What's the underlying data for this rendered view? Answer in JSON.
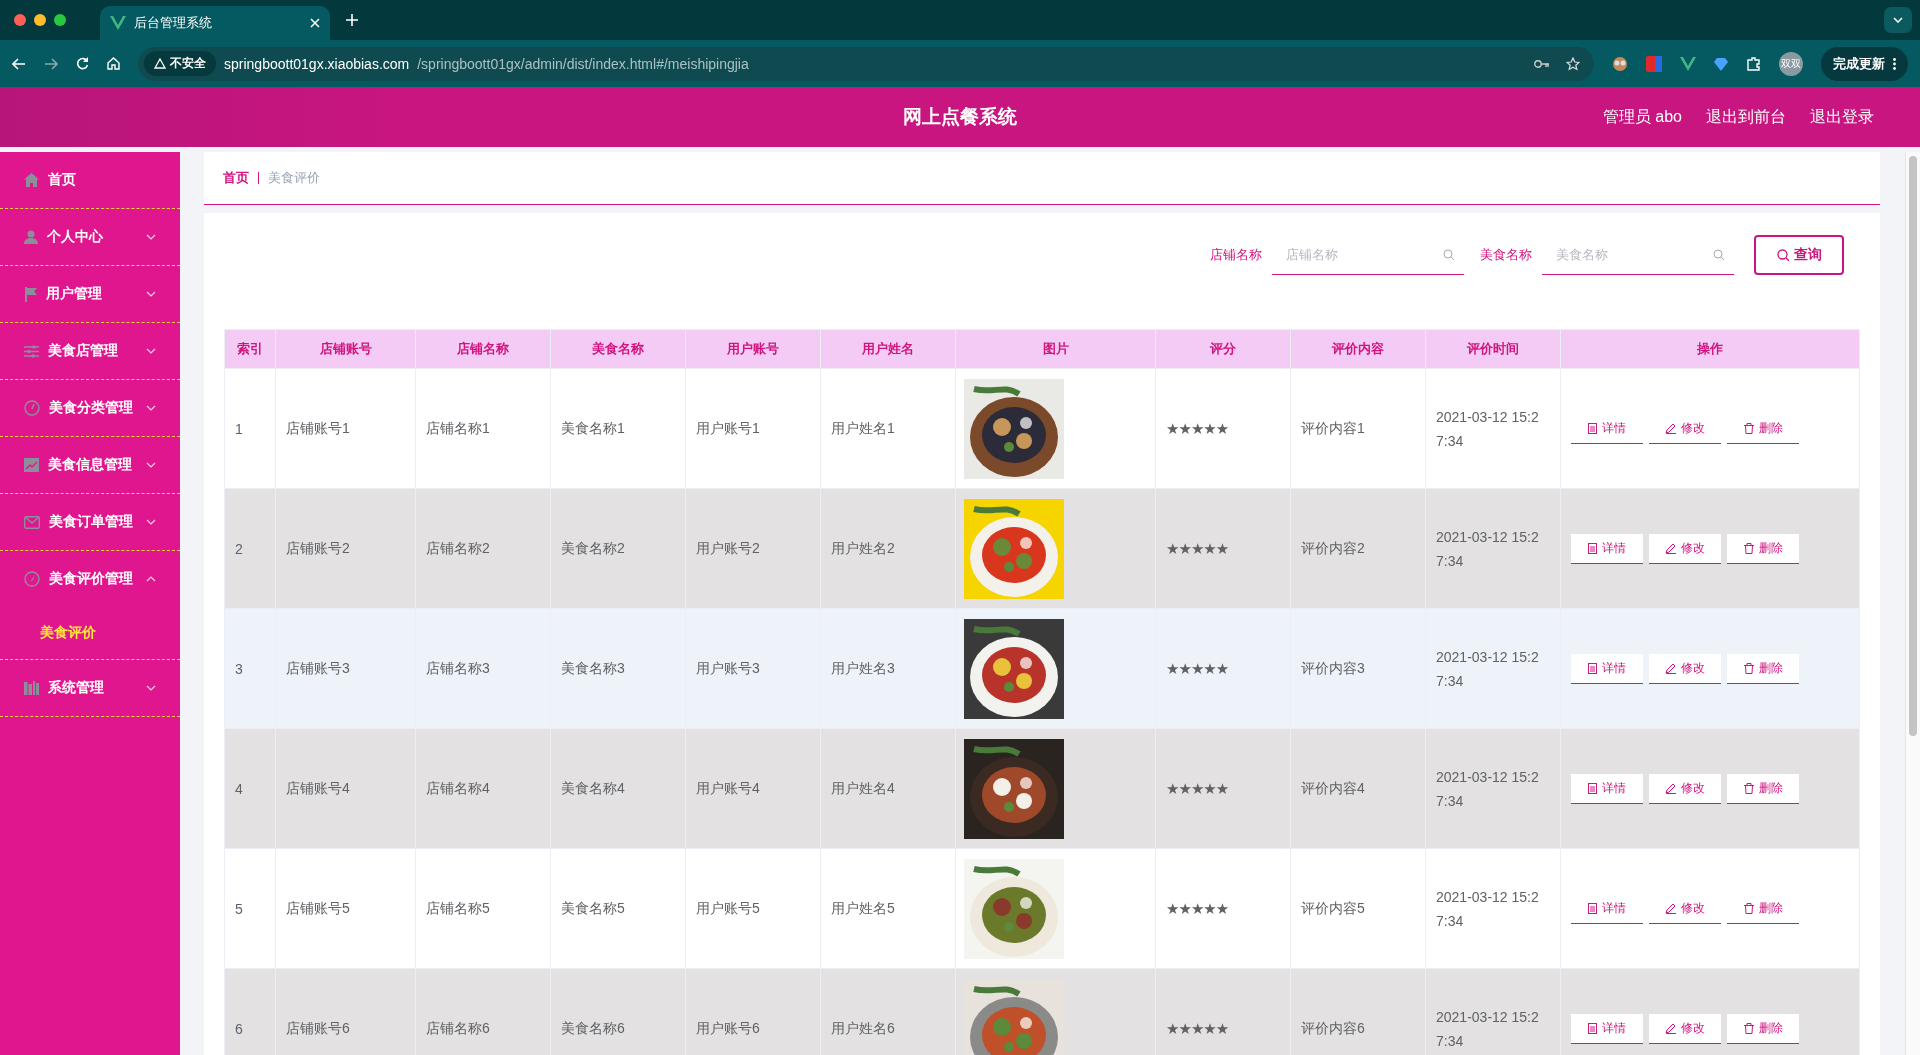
{
  "browser": {
    "tab_title": "后台管理系统",
    "security": "不安全",
    "url_host": "springboott01gx.xiaobias.com",
    "url_path": "/springboott01gx/admin/dist/index.html#/meishipingjia",
    "profile": "双双",
    "update_button": "完成更新"
  },
  "header": {
    "title": "网上点餐系统",
    "user": "管理员 abo",
    "links": [
      "退出到前台",
      "退出登录"
    ]
  },
  "sidebar": {
    "items": [
      {
        "label": "首页",
        "kind": "link"
      },
      {
        "label": "个人中心",
        "kind": "menu",
        "expanded": false
      },
      {
        "label": "用户管理",
        "kind": "menu",
        "expanded": false
      },
      {
        "label": "美食店管理",
        "kind": "menu",
        "expanded": false
      },
      {
        "label": "美食分类管理",
        "kind": "menu",
        "expanded": false
      },
      {
        "label": "美食信息管理",
        "kind": "menu",
        "expanded": false
      },
      {
        "label": "美食订单管理",
        "kind": "menu",
        "expanded": false
      },
      {
        "label": "美食评价管理",
        "kind": "menu",
        "expanded": true,
        "children": [
          {
            "label": "美食评价",
            "selected": true
          }
        ]
      },
      {
        "label": "系统管理",
        "kind": "menu",
        "expanded": false
      }
    ]
  },
  "breadcrumb": [
    "首页",
    "美食评价"
  ],
  "search": {
    "fields": [
      {
        "label": "店铺名称",
        "placeholder": "店铺名称"
      },
      {
        "label": "美食名称",
        "placeholder": "美食名称"
      }
    ],
    "button": "查询"
  },
  "table": {
    "columns": [
      "索引",
      "店铺账号",
      "店铺名称",
      "美食名称",
      "用户账号",
      "用户姓名",
      "图片",
      "评分",
      "评价内容",
      "评价时间",
      "操作"
    ],
    "rows": [
      {
        "cells": [
          "1",
          "店铺账号1",
          "店铺名称1",
          "美食名称1",
          "用户账号1",
          "用户姓名1"
        ],
        "rating": "★★★★★",
        "content": "评价内容1",
        "time": "2021-03-12 15:27:34",
        "actions": [
          "详情",
          "修改",
          "删除"
        ],
        "striped": false,
        "hovered": false
      },
      {
        "cells": [
          "2",
          "店铺账号2",
          "店铺名称2",
          "美食名称2",
          "用户账号2",
          "用户姓名2"
        ],
        "rating": "★★★★★",
        "content": "评价内容2",
        "time": "2021-03-12 15:27:34",
        "actions": [
          "详情",
          "修改",
          "删除"
        ],
        "striped": true,
        "hovered": false
      },
      {
        "cells": [
          "3",
          "店铺账号3",
          "店铺名称3",
          "美食名称3",
          "用户账号3",
          "用户姓名3"
        ],
        "rating": "★★★★★",
        "content": "评价内容3",
        "time": "2021-03-12 15:27:34",
        "actions": [
          "详情",
          "修改",
          "删除"
        ],
        "striped": false,
        "hovered": true
      },
      {
        "cells": [
          "4",
          "店铺账号4",
          "店铺名称4",
          "美食名称4",
          "用户账号4",
          "用户姓名4"
        ],
        "rating": "★★★★★",
        "content": "评价内容4",
        "time": "2021-03-12 15:27:34",
        "actions": [
          "详情",
          "修改",
          "删除"
        ],
        "striped": true,
        "hovered": false
      },
      {
        "cells": [
          "5",
          "店铺账号5",
          "店铺名称5",
          "美食名称5",
          "用户账号5",
          "用户姓名5"
        ],
        "rating": "★★★★★",
        "content": "评价内容5",
        "time": "2021-03-12 15:27:34",
        "actions": [
          "详情",
          "修改",
          "删除"
        ],
        "striped": false,
        "hovered": false
      },
      {
        "cells": [
          "6",
          "店铺账号6",
          "店铺名称6",
          "美食名称6",
          "用户账号6",
          "用户姓名6"
        ],
        "rating": "★★★★★",
        "content": "评价内容6",
        "time": "2021-03-12 15:27:34",
        "actions": [
          "详情",
          "修改",
          "删除"
        ],
        "striped": true,
        "hovered": false
      }
    ]
  }
}
